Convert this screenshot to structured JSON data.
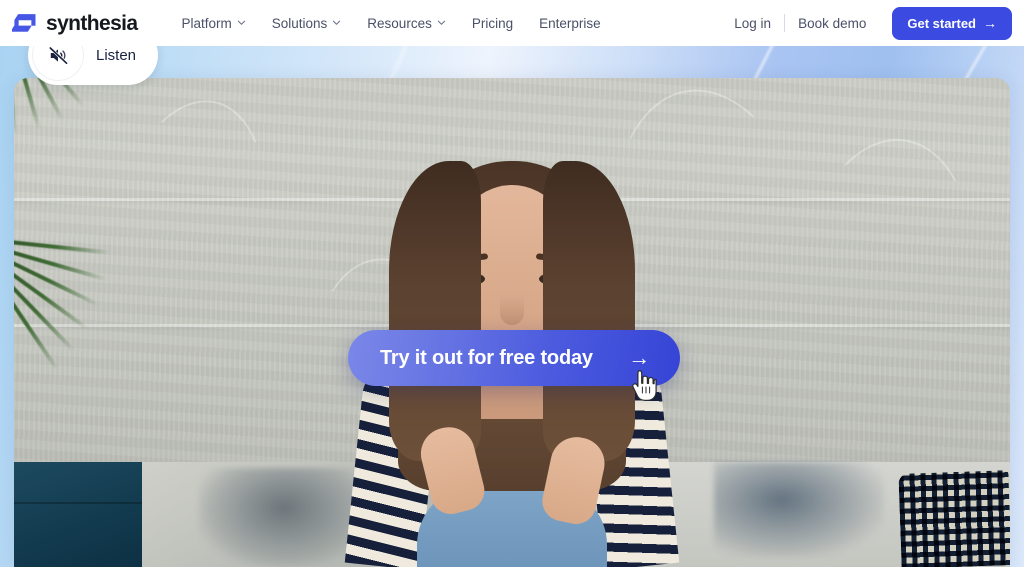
{
  "header": {
    "brand": {
      "name": "synthesia",
      "logo_icon": "synthesia-logo-icon"
    },
    "nav_items": [
      {
        "label": "Platform",
        "has_dropdown": true,
        "icon": "chevron-down-icon"
      },
      {
        "label": "Solutions",
        "has_dropdown": true,
        "icon": "chevron-down-icon"
      },
      {
        "label": "Resources",
        "has_dropdown": true,
        "icon": "chevron-down-icon"
      },
      {
        "label": "Pricing",
        "has_dropdown": false
      },
      {
        "label": "Enterprise",
        "has_dropdown": false
      }
    ],
    "login_label": "Log in",
    "book_demo_label": "Book demo",
    "get_started_label": "Get started",
    "get_started_arrow": "→"
  },
  "hero": {
    "video_player": {
      "listen_button": {
        "label": "Listen",
        "icon": "speaker-muted-icon",
        "state": "muted"
      },
      "overlay_cta": {
        "label": "Try it out for free today",
        "arrow": "→"
      },
      "cursor_icon": "pointing-hand-cursor-icon",
      "scene_description": "woman seated on sofa speaking to camera"
    }
  },
  "colors": {
    "brand_blue": "#3b4ae0",
    "cta_gradient_start": "#7b87e8",
    "cta_gradient_end": "#3644d6",
    "nav_text": "#4a5168",
    "brand_text": "#16181f",
    "hero_bg_light": "#dce9fb",
    "hero_bg_blue": "#a9c4f2",
    "listen_text": "#1b2340"
  }
}
